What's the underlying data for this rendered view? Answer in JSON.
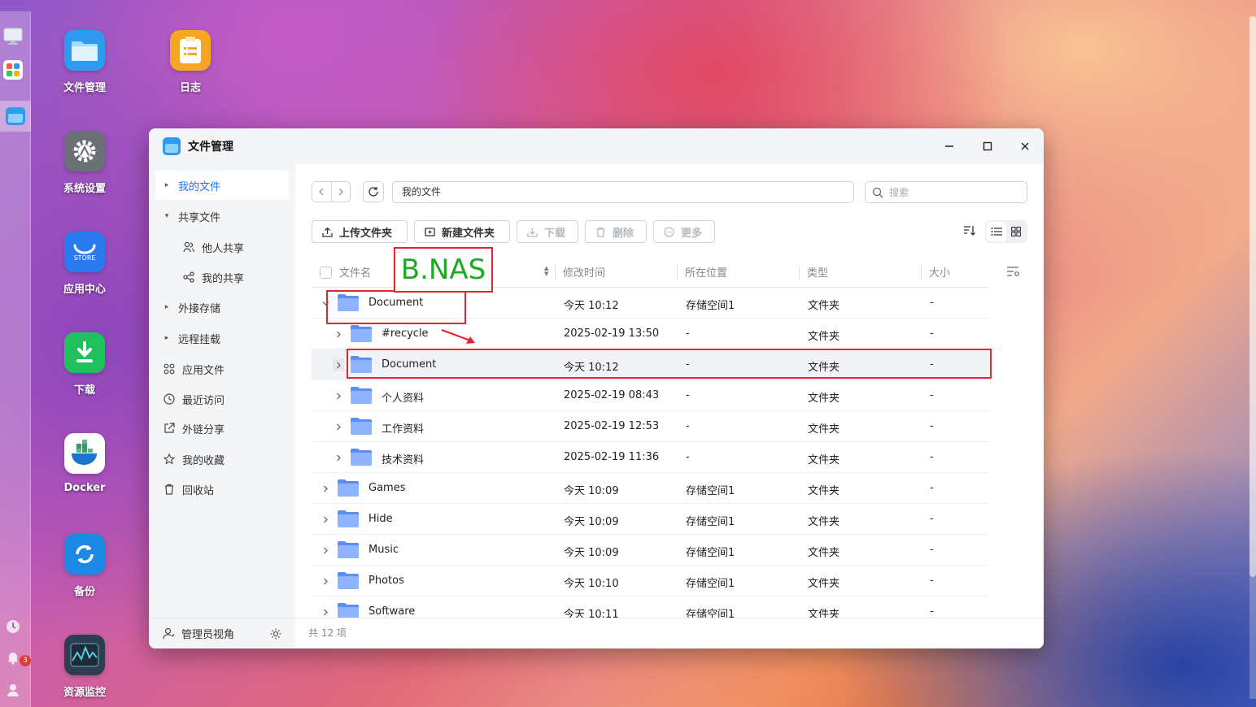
{
  "dock": {
    "items": [
      {
        "icon": "monitor-icon"
      },
      {
        "icon": "app-grid-icon"
      },
      {
        "icon": "file-manager-icon",
        "active": true
      }
    ],
    "bottom_icons": [
      "clock-icon",
      "bell-icon",
      "user-icon"
    ],
    "notification_count": "3"
  },
  "desktop": {
    "icons": [
      {
        "label": "文件管理",
        "icon": "folder-app-icon",
        "color": "#2f9bf0"
      },
      {
        "label": "日志",
        "icon": "notes-app-icon",
        "color": "#f5a623"
      },
      {
        "label": "系统设置",
        "icon": "settings-gear-icon",
        "color": "#6b6f76"
      },
      {
        "label": "应用中心",
        "icon": "store-icon",
        "color": "#2a7bf0",
        "badge_text": "STORE"
      },
      {
        "label": "下载",
        "icon": "download-icon",
        "color": "#20c05c"
      },
      {
        "label": "Docker",
        "icon": "docker-icon",
        "color": "#ffffff"
      },
      {
        "label": "备份",
        "icon": "backup-sync-icon",
        "color": "#1e88e5"
      },
      {
        "label": "资源监控",
        "icon": "resource-monitor-icon",
        "color": "#2c3e50"
      }
    ]
  },
  "window": {
    "title": "文件管理",
    "sidebar": {
      "items": [
        {
          "label": "我的文件",
          "caret": "▸",
          "active": true
        },
        {
          "label": "共享文件",
          "caret": "▾"
        },
        {
          "label": "他人共享",
          "icon": "people-icon",
          "indent": true
        },
        {
          "label": "我的共享",
          "icon": "share-icon",
          "indent": true
        },
        {
          "label": "外接存储",
          "caret": "▸"
        },
        {
          "label": "远程挂载",
          "caret": "▸"
        },
        {
          "label": "应用文件",
          "icon": "apps-icon"
        },
        {
          "label": "最近访问",
          "icon": "clock-icon"
        },
        {
          "label": "外链分享",
          "icon": "external-link-icon"
        },
        {
          "label": "我的收藏",
          "icon": "star-icon"
        },
        {
          "label": "回收站",
          "icon": "trash-icon"
        }
      ],
      "footer_label": "管理员视角"
    },
    "path": "我的文件",
    "search_placeholder": "搜索",
    "toolbar": {
      "upload": "上传文件夹",
      "new_folder": "新建文件夹",
      "download": "下载",
      "delete": "删除",
      "more": "更多"
    },
    "columns": {
      "name": "文件名",
      "modified": "修改时间",
      "location": "所在位置",
      "type": "类型",
      "size": "大小"
    },
    "rows": [
      {
        "name": "Document",
        "level": 0,
        "expanded": true,
        "modified": "今天 10:12",
        "location": "存储空间1",
        "type": "文件夹",
        "size": "-"
      },
      {
        "name": "#recycle",
        "level": 1,
        "modified": "2025-02-19 13:50",
        "location": "-",
        "type": "文件夹",
        "size": "-"
      },
      {
        "name": "Document",
        "level": 1,
        "highlighted": true,
        "modified": "今天 10:12",
        "location": "-",
        "type": "文件夹",
        "size": "-"
      },
      {
        "name": "个人资料",
        "level": 1,
        "modified": "2025-02-19 08:43",
        "location": "-",
        "type": "文件夹",
        "size": "-"
      },
      {
        "name": "工作资料",
        "level": 1,
        "modified": "2025-02-19 12:53",
        "location": "-",
        "type": "文件夹",
        "size": "-"
      },
      {
        "name": "技术资料",
        "level": 1,
        "modified": "2025-02-19 11:36",
        "location": "-",
        "type": "文件夹",
        "size": "-"
      },
      {
        "name": "Games",
        "level": 0,
        "modified": "今天 10:09",
        "location": "存储空间1",
        "type": "文件夹",
        "size": "-"
      },
      {
        "name": "Hide",
        "level": 0,
        "modified": "今天 10:09",
        "location": "存储空间1",
        "type": "文件夹",
        "size": "-"
      },
      {
        "name": "Music",
        "level": 0,
        "modified": "今天 10:09",
        "location": "存储空间1",
        "type": "文件夹",
        "size": "-"
      },
      {
        "name": "Photos",
        "level": 0,
        "modified": "今天 10:10",
        "location": "存储空间1",
        "type": "文件夹",
        "size": "-"
      },
      {
        "name": "Software",
        "level": 0,
        "modified": "今天 10:11",
        "location": "存储空间1",
        "type": "文件夹",
        "size": "-"
      }
    ],
    "status": "共 12 项"
  },
  "annotation": {
    "label": "B.NAS",
    "color": "#e8232b",
    "label_color": "#1ea828"
  }
}
